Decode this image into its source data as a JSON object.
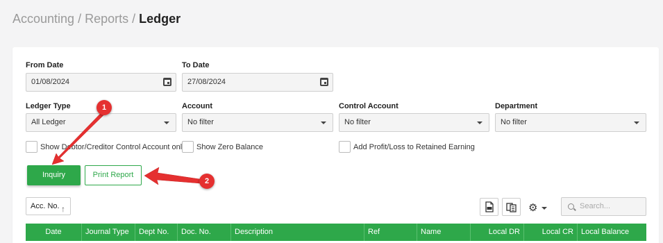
{
  "breadcrumb": {
    "part1": "Accounting",
    "part2": "Reports",
    "separator": "/",
    "current": "Ledger"
  },
  "filters": {
    "from_date": {
      "label": "From Date",
      "value": "01/08/2024"
    },
    "to_date": {
      "label": "To Date",
      "value": "27/08/2024"
    },
    "ledger_type": {
      "label": "Ledger Type",
      "value": "All Ledger"
    },
    "account": {
      "label": "Account",
      "value": "No filter"
    },
    "control_account": {
      "label": "Control Account",
      "value": "No filter"
    },
    "department": {
      "label": "Department",
      "value": "No filter"
    }
  },
  "checkboxes": {
    "show_debtor_creditor": "Show Debtor/Creditor Control Account only",
    "show_zero_balance": "Show Zero Balance",
    "add_profit_loss": "Add Profit/Loss to Retained Earning"
  },
  "buttons": {
    "inquiry": "Inquiry",
    "print_report": "Print Report"
  },
  "toolbar": {
    "sort_label": "Acc. No.",
    "sort_arrow": "↑",
    "search_placeholder": "Search..."
  },
  "table": {
    "columns": [
      "Date",
      "Journal Type",
      "Dept No.",
      "Doc. No.",
      "Description",
      "Ref",
      "Name",
      "Local DR",
      "Local CR",
      "Local Balance"
    ]
  },
  "annotations": {
    "badge1": "1",
    "badge2": "2",
    "color": "#e53030"
  },
  "colors": {
    "accent": "#2ea84a"
  }
}
